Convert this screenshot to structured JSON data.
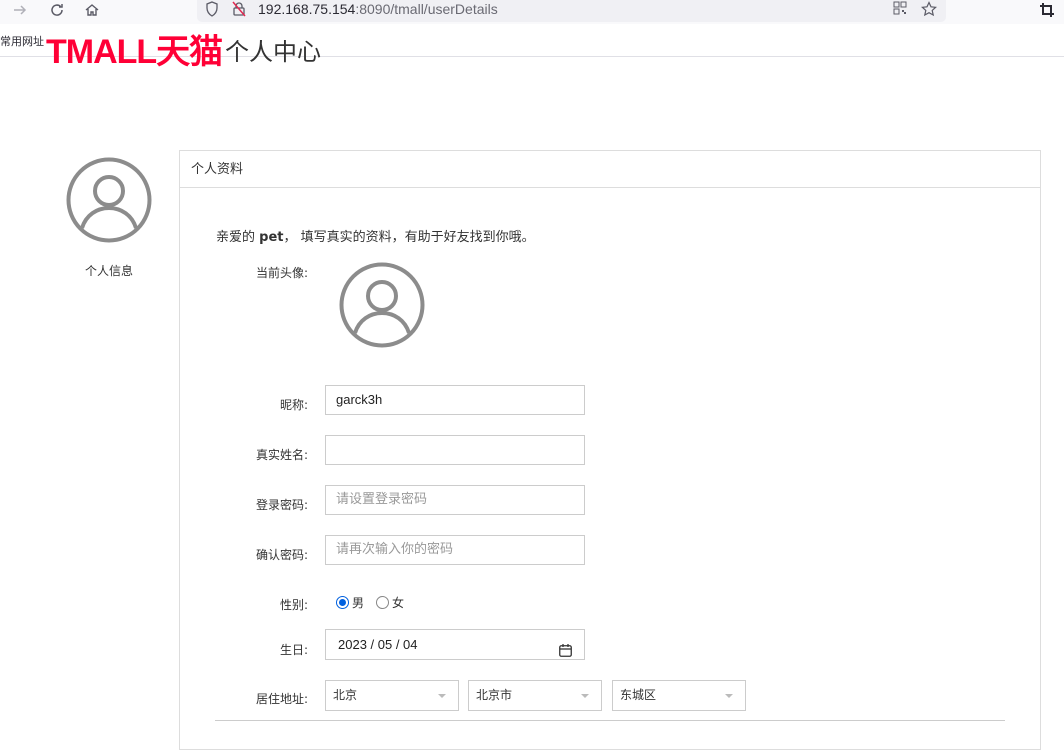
{
  "browser": {
    "url_host": "192.168.75.154",
    "url_path": ":8090/tmall/userDetails",
    "bookmarks_label": "常用网址"
  },
  "header": {
    "logo_text": "TMALL天猫",
    "title": "个人中心"
  },
  "sidebar": {
    "menu_label": "个人信息"
  },
  "panel": {
    "title": "个人资料",
    "greeting_prefix": "亲爱的",
    "username": "pet",
    "greeting_suffix": "， 填写真实的资料，有助于好友找到你哦。"
  },
  "form": {
    "avatar_label": "当前头像:",
    "nickname_label": "昵称:",
    "nickname_value": "garck3h",
    "realname_label": "真实姓名:",
    "realname_value": "",
    "password_label": "登录密码:",
    "password_placeholder": "请设置登录密码",
    "confirm_label": "确认密码:",
    "confirm_placeholder": "请再次输入你的密码",
    "gender_label": "性别:",
    "gender_male": "男",
    "gender_female": "女",
    "gender_selected": "male",
    "birthday_label": "生日:",
    "birthday_value": "2023 / 05 / 04",
    "address_label": "居住地址:",
    "province": "北京",
    "city": "北京市",
    "district": "东城区"
  },
  "colors": {
    "brand": "#ff0036",
    "radio_accent": "#0060df"
  }
}
